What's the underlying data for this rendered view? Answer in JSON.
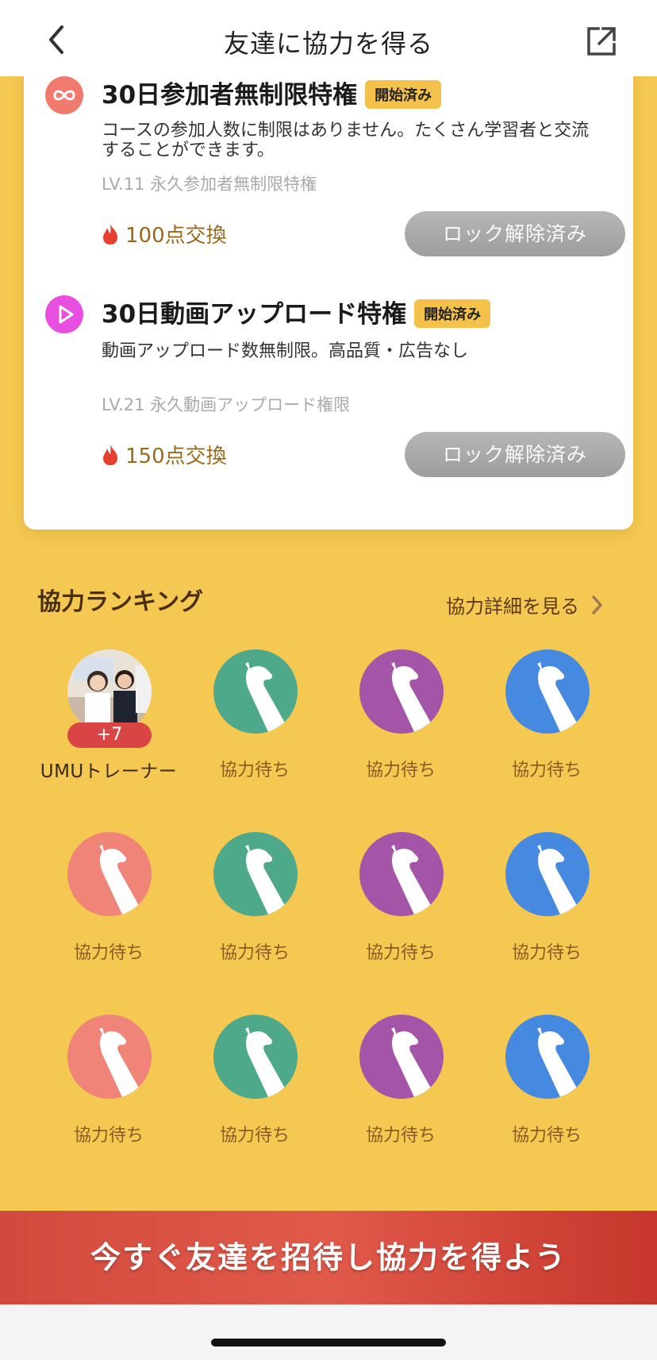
{
  "header": {
    "title": "友達に協力を得る"
  },
  "privileges": [
    {
      "title": "30日参加者無制限特権",
      "badge": "開始済み",
      "description": "コースの参加人数に制限はありません。たくさん学習者と交流することができます。",
      "level": "LV.11 永久参加者無制限特権",
      "cost": "100点交換",
      "button": "ロック解除済み",
      "icon": "infinity-icon",
      "icon_color": "#F07A6E"
    },
    {
      "title": "30日動画アップロード特権",
      "badge": "開始済み",
      "description": "動画アップロード数無制限。高品質・広告なし",
      "level": "LV.21 永久動画アップロード権限",
      "cost": "150点交換",
      "button": "ロック解除済み",
      "icon": "play-icon",
      "icon_color": "#E84FE0"
    }
  ],
  "ranking": {
    "title": "協力ランキング",
    "detail_link": "協力詳細を見る",
    "first": {
      "name": "UMUトレーナー",
      "count": "+7"
    },
    "pending_label": "協力待ち",
    "placeholder_colors": [
      "#F08478",
      "#4EA88A",
      "#A555A8",
      "#4589E0"
    ]
  },
  "cta": {
    "label": "今すぐ友達を招待し協力を得よう"
  },
  "colors": {
    "background": "#F5C951",
    "cta": "#D24A3D",
    "badge": "#F4C24A"
  }
}
